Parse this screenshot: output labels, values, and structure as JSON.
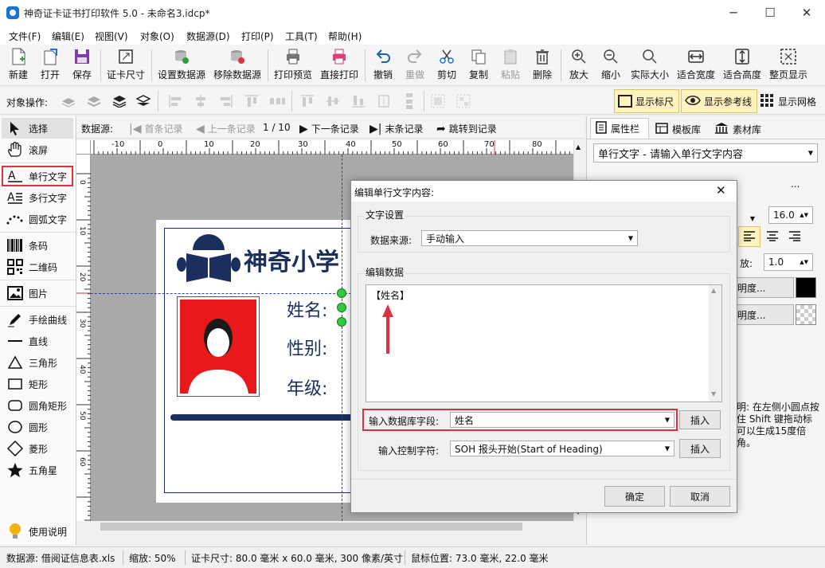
{
  "window": {
    "title": "神奇证卡证书打印软件 5.0 - 未命名3.idcp*"
  },
  "menu": [
    "文件(F)",
    "编辑(E)",
    "视图(V)",
    "对象(O)",
    "数据源(D)",
    "打印(P)",
    "工具(T)",
    "帮助(H)"
  ],
  "toolbar": {
    "new": "新建",
    "open": "打开",
    "save": "保存",
    "card_size": "证卡尺寸",
    "set_source": "设置数据源",
    "remove_source": "移除数据源",
    "print_preview": "打印预览",
    "direct_print": "直接打印",
    "undo": "撤销",
    "redo": "重做",
    "cut": "剪切",
    "copy": "复制",
    "paste": "粘贴",
    "delete": "删除",
    "zoom_in": "放大",
    "zoom_out": "缩小",
    "actual_size": "实际大小",
    "fit_width": "适合宽度",
    "fit_height": "适合高度",
    "full_page": "整页显示"
  },
  "objbar": {
    "label": "对象操作:",
    "show_ruler": "显示标尺",
    "show_guides": "显示参考线",
    "show_grid": "显示网格"
  },
  "tools": [
    "选择",
    "滚屏",
    "单行文字",
    "多行文字",
    "圆弧文字",
    "条码",
    "二维码",
    "图片",
    "手绘曲线",
    "直线",
    "三角形",
    "矩形",
    "圆角矩形",
    "圆形",
    "菱形",
    "五角星",
    "使用说明"
  ],
  "nav": {
    "label": "数据源:",
    "first": "首条记录",
    "prev": "上一条记录",
    "page": "1 / 10",
    "next": "下一条记录",
    "last": "末条记录",
    "jump": "跳转到记录"
  },
  "ruler": {
    "top": [
      "-10",
      "0",
      "10",
      "20",
      "30",
      "40",
      "50",
      "60",
      "70",
      "80"
    ],
    "left": [
      "0",
      "10",
      "20",
      "30",
      "40",
      "50",
      "60"
    ]
  },
  "card": {
    "school": "神奇小学",
    "field_name": "姓名:",
    "field_gender": "性别:",
    "field_grade": "年级:"
  },
  "rightpanel": {
    "tab_props": "属性栏",
    "tab_templates": "模板库",
    "tab_assets": "素材库",
    "object_select": "单行文字 - 请输入单行文字内容",
    "font_size": "16.0",
    "spacing_label": "放:",
    "spacing_value": "1.0",
    "transp1": "明度...",
    "transp2": "明度...",
    "hint": "明: 在左侧小圆点按住 Shift 键拖动标可以生成15度倍角。"
  },
  "dialog": {
    "title": "编辑单行文字内容:",
    "group_text": "文字设置",
    "source_label": "数据来源:",
    "source_value": "手动输入",
    "group_data": "编辑数据",
    "content": "【姓名】",
    "field_label": "输入数据库字段:",
    "field_value": "姓名",
    "insert1": "插入",
    "ctrl_label": "输入控制字符:",
    "ctrl_value": "SOH  报头开始(Start of Heading)",
    "insert2": "插入",
    "ok": "确定",
    "cancel": "取消"
  },
  "status": {
    "source": "数据源: 借阅证信息表.xls",
    "zoom": "缩放: 50%",
    "size": "证卡尺寸: 80.0 毫米 x 60.0 毫米, 300 像素/英寸",
    "mouse": "鼠标位置: 73.0 毫米, 22.0 毫米"
  },
  "colors": {
    "navy": "#1a2f5e",
    "red": "#d9333f",
    "blue": "#1a73d9"
  }
}
